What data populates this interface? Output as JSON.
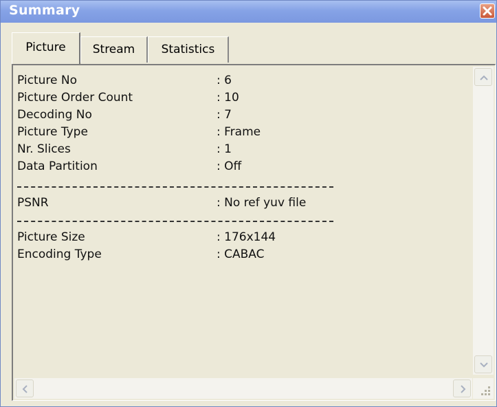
{
  "window": {
    "title": "Summary",
    "close_icon": "close-icon",
    "accent": "#7b98e0",
    "close_color": "#c9583a"
  },
  "tabs": [
    {
      "label": "Picture",
      "active": true
    },
    {
      "label": "Stream",
      "active": false
    },
    {
      "label": "Statistics",
      "active": false
    }
  ],
  "summary": {
    "rows": [
      {
        "label": "Picture No",
        "value": ": 6"
      },
      {
        "label": "Picture Order Count",
        "value": ": 10"
      },
      {
        "label": "Decoding No",
        "value": ": 7"
      },
      {
        "label": "Picture Type",
        "value": ": Frame"
      },
      {
        "label": "Nr. Slices",
        "value": ": 1"
      },
      {
        "label": "Data Partition",
        "value": ": Off"
      }
    ],
    "psnr": {
      "label": "PSNR",
      "value": ": No ref yuv file"
    },
    "rows2": [
      {
        "label": "Picture Size",
        "value": ": 176x144"
      },
      {
        "label": "Encoding Type",
        "value": ": CABAC"
      }
    ]
  },
  "scrollbars": {
    "up_icon": "chevron-up-icon",
    "down_icon": "chevron-down-icon",
    "left_icon": "chevron-left-icon",
    "right_icon": "chevron-right-icon",
    "grip_icon": "resize-grip-icon"
  }
}
